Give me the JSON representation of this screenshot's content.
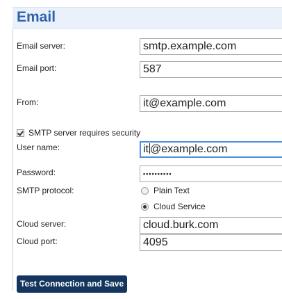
{
  "section": {
    "title": "Email"
  },
  "fields": {
    "email_server": {
      "label": "Email server:",
      "value": "smtp.example.com"
    },
    "email_port": {
      "label": "Email port:",
      "value": "587"
    },
    "from": {
      "label": "From:",
      "value": "it@example.com"
    },
    "user_name": {
      "label": "User name:",
      "value_before_cursor": "it",
      "value_after_cursor": "@example.com"
    },
    "password": {
      "label": "Password:",
      "masked_value": "••••••••••"
    },
    "cloud_server": {
      "label": "Cloud server:",
      "value": "cloud.burk.com"
    },
    "cloud_port": {
      "label": "Cloud port:",
      "value": "4095"
    }
  },
  "security": {
    "label": "SMTP server requires security",
    "checked": true
  },
  "smtp_protocol": {
    "label": "SMTP protocol:",
    "options": [
      "Plain Text",
      "Cloud Service"
    ],
    "selected": "Cloud Service"
  },
  "actions": {
    "test_save_label": "Test Connection and Save"
  },
  "colors": {
    "title": "#2d63ad",
    "header_bg": "#eaf1fb",
    "button_bg": "#14365e",
    "active_border": "#4b8fe0"
  },
  "icons": {
    "checkbox": "checkbox-checked-icon",
    "radio_unselected": "radio-unselected-icon",
    "radio_selected": "radio-selected-icon"
  }
}
